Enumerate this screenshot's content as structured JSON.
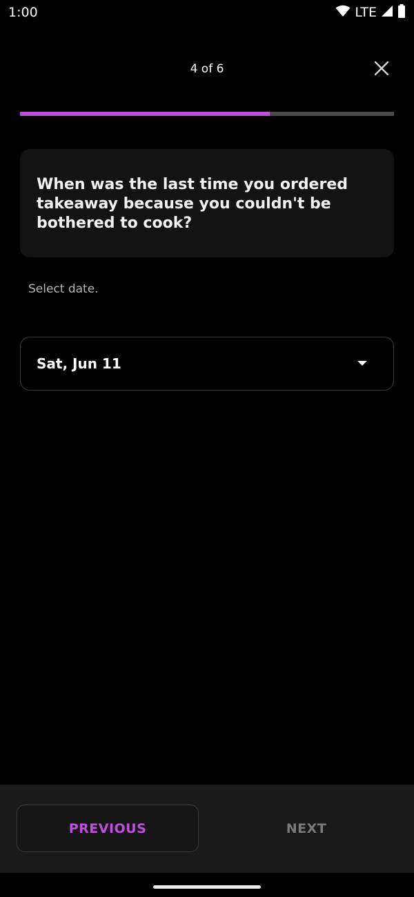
{
  "status_bar": {
    "time": "1:00",
    "network": "LTE",
    "icons": [
      "wifi-icon",
      "signal-icon",
      "battery-icon"
    ]
  },
  "header": {
    "step_counter": "4 of 6",
    "close_icon": "close-icon",
    "progress_fraction": 0.667
  },
  "question": {
    "text": "When was the last time you ordered takeaway because you couldn't be bothered to cook?"
  },
  "answer": {
    "helper_text": "Select date.",
    "selected_date": "Sat, Jun 11",
    "dropdown_icon": "chevron-down-icon"
  },
  "footer": {
    "previous_label": "PREVIOUS",
    "next_label": "NEXT"
  },
  "colors": {
    "accent": "#c04ee0",
    "background": "#000000",
    "card": "#131313",
    "disabled_text": "#7a7a7a"
  }
}
